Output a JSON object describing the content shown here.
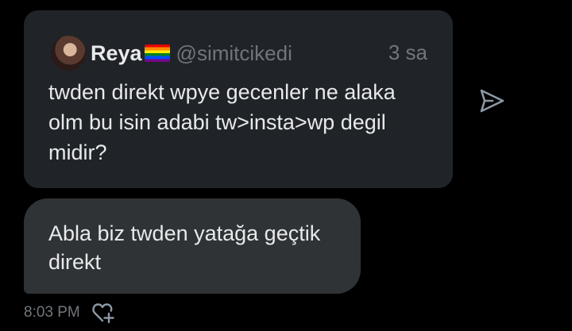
{
  "quoted_tweet": {
    "author_name": "Reya",
    "author_handle": "@simitcikedi",
    "time_ago": "3 sa",
    "text": "twden direkt wpye gecenler ne alaka\nolm bu isin adabi tw>insta>wp degil\nmidir?"
  },
  "reply_message": {
    "text": "Abla biz twden yatağa geçtik\ndirekt"
  },
  "message_meta": {
    "timestamp": "8:03 PM"
  },
  "icons": {
    "share": "send-icon",
    "react": "heart-plus-icon",
    "flag": "rainbow-flag-icon"
  }
}
